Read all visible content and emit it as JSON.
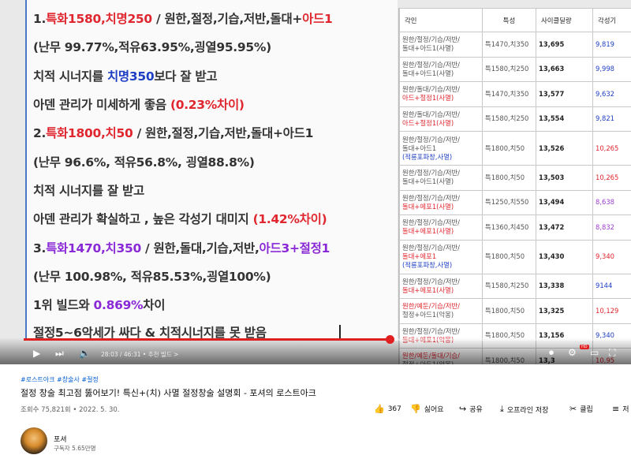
{
  "slide": {
    "l1": {
      "a": "1.",
      "b": "특화1580,치명250",
      "c": " / 원한,절정,기습,저반,돌대+",
      "d": "아드1"
    },
    "l2": "(난무 99.77%,적유63.95%,굉열95.95%)",
    "l3": {
      "a": "치적 시너지를 ",
      "b": "치명350",
      "c": "보다 잘 받고"
    },
    "l4": {
      "a": "아덴 관리가 미세하게 좋음 ",
      "b": "(0.23%차이)"
    },
    "l5": {
      "a": "2.",
      "b": "특화1800,치50",
      "c": " / 원한,절정,기습,저반,돌대+아드1"
    },
    "l6": "(난무 96.6%, 적유56.8%, 굉열88.8%)",
    "l7": "치적 시너지를 잘 받고",
    "l8": {
      "a": "아덴 관리가 확실하고 , 높은 각성기 대미지 ",
      "b": "(1.42%차이)"
    },
    "l9": {
      "a": "3.",
      "b": "특화1470,치350",
      "c": " / 원한,돌대,기습,저반,",
      "d": "아드3+절정1"
    },
    "l10": "(난무 100.98%, 적유85.53%,굉열100%)",
    "l11": {
      "a": "1위 빌드와 ",
      "b": "0.869%",
      "c": "차이"
    },
    "l12": "절정5~6악세가 싸다 & 치적시너지를 못 받음"
  },
  "sheet": {
    "headers": [
      "각인",
      "특성",
      "사이클딜량",
      "각성기"
    ],
    "rows": [
      {
        "b1": "원한/절정/기습/저반/",
        "b2": "돌대+아드1(사멸)",
        "b3": "",
        "b1c": "",
        "b2c": "",
        "stat": "특1470,치350",
        "dmg": "13,695",
        "exp": "9,819",
        "expColor": "#1f3fc4"
      },
      {
        "b1": "원한/절정/기습/저반/",
        "b2": "돌대+아드1(사멸)",
        "b3": "",
        "b1c": "",
        "b2c": "",
        "stat": "특1580,치250",
        "dmg": "13,663",
        "exp": "9,998",
        "expColor": "#1f3fc4"
      },
      {
        "b1": "원한/돌대/기습/저반/",
        "b2": "아드+절정1(사멸)",
        "b3": "",
        "b1c": "",
        "b2c": "r",
        "stat": "특1470,치350",
        "dmg": "13,577",
        "exp": "9,632",
        "expColor": "#1f3fc4"
      },
      {
        "b1": "원한/돌대/기습/저반/",
        "b2": "아드+절정1(사멸)",
        "b3": "",
        "b1c": "",
        "b2c": "r",
        "stat": "특1580,치250",
        "dmg": "13,554",
        "exp": "9,821",
        "expColor": "#1f3fc4"
      },
      {
        "b1": "원한/절정/기습/저반/",
        "b2": "돌대+아드1",
        "b3": "(적룡포파창,사멸)",
        "b1c": "",
        "b2c": "",
        "stat": "특1800,치50",
        "dmg": "13,526",
        "exp": "10,265",
        "expColor": "#e0262e"
      },
      {
        "b1": "원한/절정/기습/저반/",
        "b2": "돌대+아드1(사멸)",
        "b3": "",
        "b1c": "",
        "b2c": "",
        "stat": "특1800,치50",
        "dmg": "13,503",
        "exp": "10,265",
        "expColor": "#e0262e"
      },
      {
        "b1": "원한/절정/기습/저반/",
        "b2": "돌대+에포1(사멸)",
        "b3": "",
        "b1c": "",
        "b2c": "r",
        "stat": "특1250,치550",
        "dmg": "13,494",
        "exp": "8,638",
        "expColor": "#9c3fd0"
      },
      {
        "b1": "원한/절정/기습/저반/",
        "b2": "돌대+에포1(사멸)",
        "b3": "",
        "b1c": "",
        "b2c": "r",
        "stat": "특1360,치450",
        "dmg": "13,472",
        "exp": "8,832",
        "expColor": "#9c3fd0"
      },
      {
        "b1": "원한/절정/기습/저반/",
        "b2": "돌대+에포1",
        "b3": "(적룡포파창,사멸)",
        "b1c": "",
        "b2c": "r",
        "stat": "특1800,치50",
        "dmg": "13,430",
        "exp": "9,340",
        "expColor": "#e0262e"
      },
      {
        "b1": "원한/절정/기습/저반/",
        "b2": "돌대+에포1(사멸)",
        "b3": "",
        "b1c": "",
        "b2c": "r",
        "stat": "특1580,치250",
        "dmg": "13,338",
        "exp": "9144",
        "expColor": "#1f3fc4"
      },
      {
        "b1": "원한/예둔/기습/저반/",
        "b2": "절정+아드1(악몽)",
        "b3": "",
        "b1c": "r",
        "b2c": "",
        "stat": "특1800,치50",
        "dmg": "13,325",
        "exp": "10,129",
        "expColor": "#e0262e"
      },
      {
        "b1": "원한/절정/기습/저반/",
        "b2": "돌대+에포1(악몽)",
        "b3": "",
        "b1c": "",
        "b2c": "r",
        "stat": "특1800,치50",
        "dmg": "13,156",
        "exp": "9,340",
        "expColor": "#1f3fc4"
      },
      {
        "b1": "원한/예둔/돌대/기습/",
        "b2": "절정+아드1(악몽)",
        "b3": "",
        "b1c": "r",
        "b2c": "",
        "stat": "특1800,치50",
        "dmg": "13,3",
        "exp": "10,95",
        "expColor": "#e0262e"
      }
    ]
  },
  "player": {
    "time": "28:03 / 46:31",
    "chapter": "• 추천 빌드 >",
    "progress": 0.603,
    "hd_badge": "HD"
  },
  "video": {
    "tags": "#로스트아크 #창술사 #절정",
    "title": "절정 창술 최고점 뚫어보기! 특신+(치) 사멸 절정창술 설명회 - 포셔의 로스트아크",
    "meta": "조회수 75,821회 • 2022. 5. 30.",
    "like_count": "367",
    "dislike_label": "싫어요",
    "share_label": "공유",
    "offline_label": "오프라인 저장",
    "clip_label": "클립",
    "more_label": "저",
    "channel_name": "포셔",
    "subscribers": "구독자 5.65만명"
  }
}
